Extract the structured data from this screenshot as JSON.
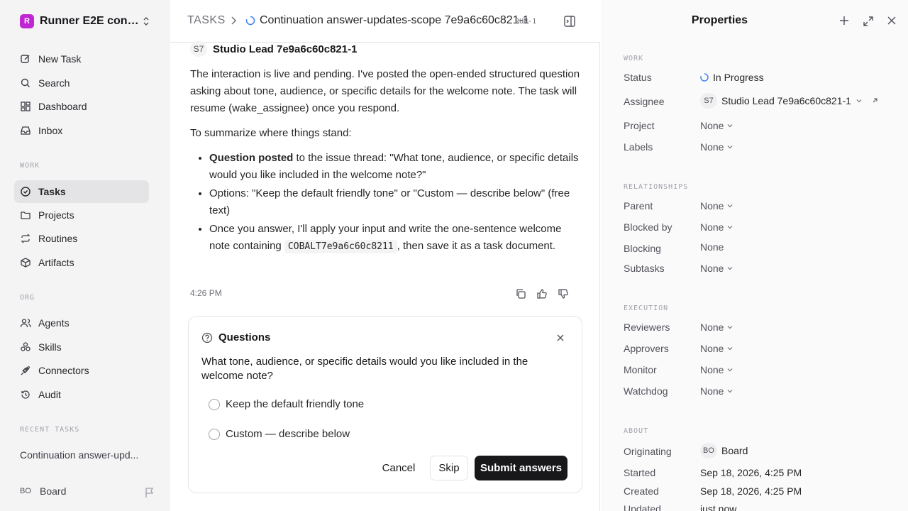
{
  "workspace": {
    "logo": "R",
    "name": "Runner E2E conti..."
  },
  "nav": {
    "new_task": "New Task",
    "search": "Search",
    "dashboard": "Dashboard",
    "inbox": "Inbox"
  },
  "work_section": {
    "label": "WORK",
    "tasks": "Tasks",
    "projects": "Projects",
    "routines": "Routines",
    "artifacts": "Artifacts"
  },
  "org_section": {
    "label": "ORG",
    "agents": "Agents",
    "skills": "Skills",
    "connectors": "Connectors",
    "audit": "Audit"
  },
  "recent": {
    "label": "RECENT TASKS",
    "item": "Continuation answer-upd..."
  },
  "user": {
    "initials": "BO",
    "name": "Board"
  },
  "header": {
    "crumb": "TASKS",
    "title": "Continuation answer-updates-scope 7e9a6c60c821-1",
    "run": "RUN-1"
  },
  "message": {
    "author_initials": "S7",
    "author": "Studio Lead 7e9a6c60c821-1",
    "para1": "The interaction is live and pending. I've posted the open-ended structured question asking about tone, audience, or specific details for the welcome note. The task will resume (wake_assignee) once you respond.",
    "para2": "To summarize where things stand:",
    "b1_bold": "Question posted",
    "b1_rest": " to the issue thread: \"What tone, audience, or specific details would you like included in the welcome note?\"",
    "b2": "Options: \"Keep the default friendly tone\" or \"Custom — describe below\" (free text)",
    "b3_pre": "Once you answer, I'll apply your input and write the one-sentence welcome note containing ",
    "b3_code": "COBALT7e9a6c60c8211",
    "b3_post": ", then save it as a task document.",
    "time": "4:26 PM"
  },
  "questions": {
    "title": "Questions",
    "text": "What tone, audience, or specific details would you like included in the welcome note?",
    "options": [
      "Keep the default friendly tone",
      "Custom — describe below"
    ],
    "cancel": "Cancel",
    "skip": "Skip",
    "submit": "Submit answers"
  },
  "properties": {
    "title": "Properties",
    "work_label": "WORK",
    "status_label": "Status",
    "status": "In Progress",
    "assignee_label": "Assignee",
    "assignee_initials": "S7",
    "assignee": "Studio Lead 7e9a6c60c821-1",
    "project_label": "Project",
    "project": "None",
    "labels_label": "Labels",
    "labels": "None",
    "rel_label": "RELATIONSHIPS",
    "parent_label": "Parent",
    "parent": "None",
    "blocked_by_label": "Blocked by",
    "blocked_by": "None",
    "blocking_label": "Blocking",
    "blocking": "None",
    "subtasks_label": "Subtasks",
    "subtasks": "None",
    "exec_label": "EXECUTION",
    "reviewers_label": "Reviewers",
    "reviewers": "None",
    "approvers_label": "Approvers",
    "approvers": "None",
    "monitor_label": "Monitor",
    "monitor": "None",
    "watchdog_label": "Watchdog",
    "watchdog": "None",
    "about_label": "ABOUT",
    "originating_label": "Originating",
    "originating_initials": "BO",
    "originating": "Board",
    "started_label": "Started",
    "started": "Sep 18, 2026, 4:25 PM",
    "created_label": "Created",
    "created": "Sep 18, 2026, 4:25 PM",
    "updated_label": "Updated",
    "updated": "just now"
  }
}
